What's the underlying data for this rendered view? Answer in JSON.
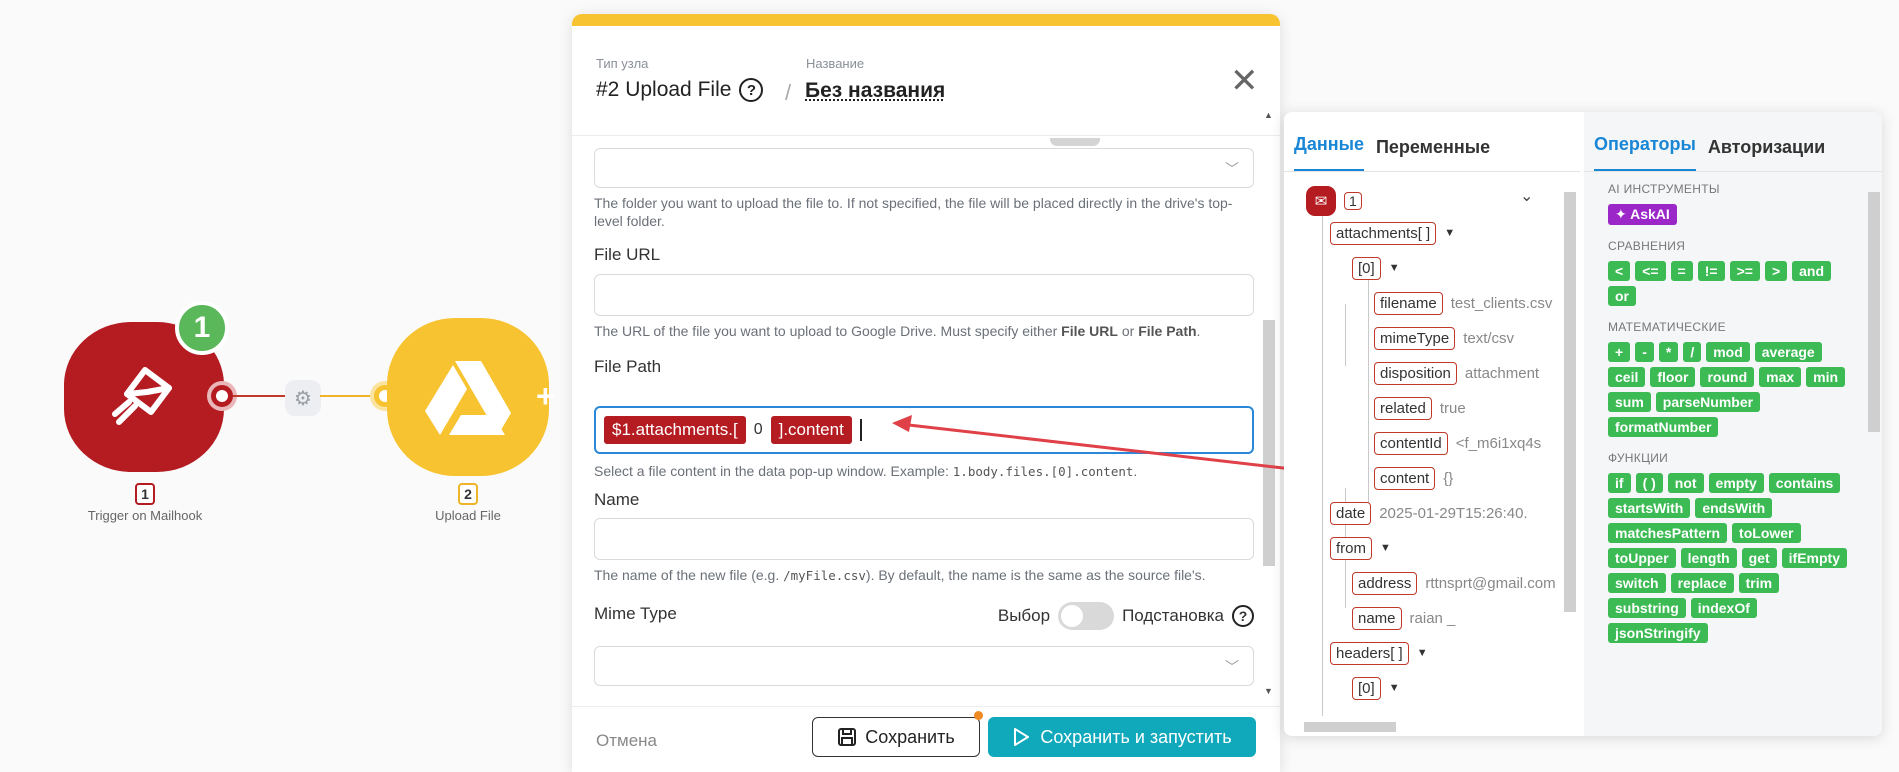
{
  "flow": {
    "node1": {
      "badge": "1",
      "number": "1",
      "label": "Trigger on Mailhook"
    },
    "node2": {
      "number": "2",
      "label": "Upload File"
    }
  },
  "modal": {
    "type_caption": "Тип узла",
    "name_caption": "Название",
    "type_value": "#2 Upload File",
    "separator": "/",
    "name_value": "Без названия",
    "folder_help": "The folder you want to upload the file to. If not specified, the file will be placed directly in the drive's top-level folder.",
    "file_url": {
      "label": "File URL",
      "help_pre": "The URL of the file you want to upload to Google Drive. Must specify either ",
      "help_b1": "File URL",
      "help_mid": " or ",
      "help_b2": "File Path",
      "help_post": "."
    },
    "file_path": {
      "label": "File Path",
      "chip1": "$1.attachments.[",
      "index": "0",
      "chip2": "].content",
      "help_pre": "Select a file content in the data pop-up window. Example: ",
      "help_code": "1.body.files.[0].content",
      "help_post": "."
    },
    "name": {
      "label": "Name",
      "help_pre": "The name of the new file (e.g. ",
      "help_code": "/myFile.csv",
      "help_post": "). By default, the name is the same as the source file's."
    },
    "mime": {
      "label": "Mime Type",
      "opt_left": "Выбор",
      "opt_right": "Подстановка"
    },
    "footer": {
      "cancel": "Отмена",
      "save": "Сохранить",
      "save_run": "Сохранить и запустить"
    }
  },
  "popup": {
    "tabs_left": [
      "Данные",
      "Переменные"
    ],
    "tabs_right": [
      "Операторы",
      "Авторизации"
    ],
    "tree": {
      "root_num": "1",
      "attachments": "attachments[ ]",
      "idx0": "[0]",
      "filename": {
        "key": "filename",
        "value": "test_clients.csv"
      },
      "mimeType": {
        "key": "mimeType",
        "value": "text/csv"
      },
      "disposition": {
        "key": "disposition",
        "value": "attachment"
      },
      "related": {
        "key": "related",
        "value": "true"
      },
      "contentId": {
        "key": "contentId",
        "value": "<f_m6i1xq4s"
      },
      "content": {
        "key": "content",
        "value": "{}"
      },
      "date": {
        "key": "date",
        "value": "2025-01-29T15:26:40."
      },
      "from": "from",
      "address": {
        "key": "address",
        "value": "rttnsprt@gmail.com"
      },
      "fname": {
        "key": "name",
        "value": "raian _"
      },
      "headers": "headers[ ]",
      "hidx0": "[0]"
    },
    "operators": {
      "ai_title": "AI ИНСТРУМЕНТЫ",
      "ai": [
        "AskAI"
      ],
      "cmp_title": "СРАВНЕНИЯ",
      "cmp": [
        "<",
        "<=",
        "=",
        "!=",
        ">=",
        ">",
        "and",
        "or"
      ],
      "math_title": "МАТЕМАТИЧЕСКИЕ",
      "math": [
        "+",
        "-",
        "*",
        "/",
        "mod",
        "average",
        "ceil",
        "floor",
        "round",
        "max",
        "min",
        "sum",
        "parseNumber",
        "formatNumber"
      ],
      "fn_title": "ФУНКЦИИ",
      "fn": [
        "if",
        "( )",
        "not",
        "empty",
        "contains",
        "startsWith",
        "endsWith",
        "matchesPattern",
        "toLower",
        "toUpper",
        "length",
        "get",
        "ifEmpty",
        "switch",
        "replace",
        "trim",
        "substring",
        "indexOf",
        "jsonStringify"
      ]
    }
  },
  "colors": {
    "accent": "#1a86d6",
    "trigger": "#b51c22",
    "drive": "#f7c331",
    "run_button": "#10a8bb",
    "operator": "#3cba54"
  }
}
